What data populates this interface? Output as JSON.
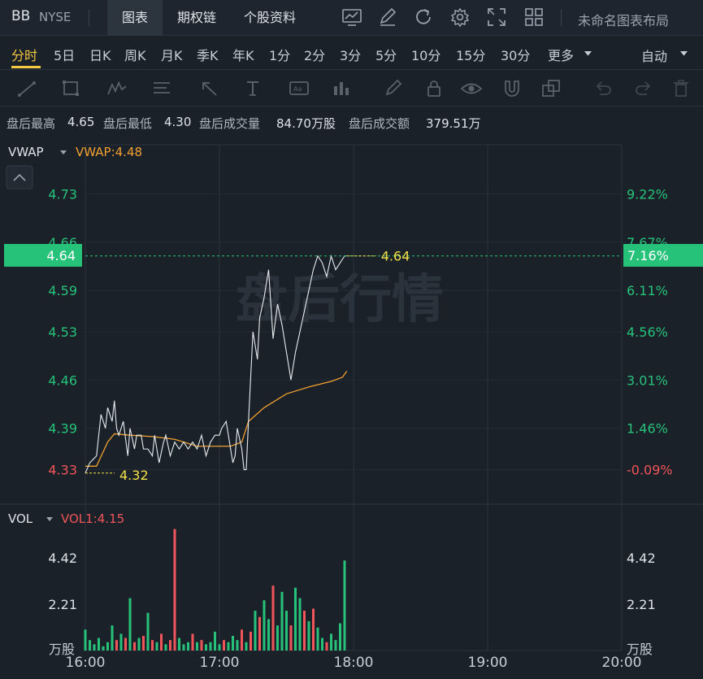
{
  "header": {
    "symbol": "BB",
    "exchange": "NYSE",
    "tabs": [
      {
        "label": "图表",
        "active": true
      },
      {
        "label": "期权链",
        "active": false
      },
      {
        "label": "个股资料",
        "active": false
      }
    ],
    "layout_name": "未命名图表布局"
  },
  "toolbar_icons": [
    "indicator-icon",
    "draw-icon",
    "refresh-icon",
    "settings-icon",
    "fullscreen-icon",
    "layout-grid-icon"
  ],
  "periods": {
    "items": [
      "分时",
      "5日",
      "日K",
      "周K",
      "月K",
      "季K",
      "年K",
      "1分",
      "2分",
      "3分",
      "5分",
      "10分",
      "15分",
      "30分",
      "更多"
    ],
    "active": "分时",
    "auto_label": "自动"
  },
  "drawing_tools": [
    "trend-line-icon",
    "rectangle-icon",
    "pattern-icon",
    "fib-icon",
    "arrow-icon",
    "text-icon",
    "note-icon",
    "measure-icon",
    "brush-icon",
    "lock-icon",
    "eye-icon",
    "magnet-icon",
    "copy-icon",
    "undo-icon",
    "redo-icon",
    "trash-icon"
  ],
  "info": {
    "high_label": "盘后最高",
    "high_value": "4.65",
    "low_label": "盘后最低",
    "low_value": "4.30",
    "volume_label": "盘后成交量",
    "volume_value": "84.70万股",
    "amount_label": "盘后成交额",
    "amount_value": "379.51万"
  },
  "price_panel": {
    "indicator_name": "VWAP",
    "indicator_value": "VWAP:4.48",
    "watermark": "盘后行情",
    "last_price_label": "4.64",
    "last_pct_label": "7.16%",
    "max_label": "4.64",
    "min_label": "4.32",
    "colors": {
      "up": "#27c27a",
      "down": "#f0555a",
      "vwap": "#f0a030",
      "price": "#e8ecf0",
      "marker": "#f5e14a"
    }
  },
  "volume_panel": {
    "indicator_name": "VOL",
    "indicator_value": "VOL1:4.15",
    "unit_label": "万股"
  },
  "chart_data": {
    "type": "line",
    "xlabel": "",
    "ylabel": "",
    "x_ticks": [
      "16:00",
      "17:00",
      "18:00",
      "19:00",
      "20:00"
    ],
    "x_range": [
      "16:00",
      "20:00"
    ],
    "price_ticks": [
      "4.73",
      "4.66",
      "4.59",
      "4.53",
      "4.46",
      "4.39",
      "4.33"
    ],
    "pct_ticks": [
      "9.22%",
      "7.67%",
      "6.11%",
      "4.56%",
      "3.01%",
      "1.46%",
      "-0.09%"
    ],
    "ylim": [
      4.3,
      4.76
    ],
    "series": [
      {
        "name": "VWAP",
        "x": [
          "16:00",
          "16:05",
          "16:10",
          "16:13",
          "16:20",
          "16:30",
          "16:40",
          "16:50",
          "17:00",
          "17:05",
          "17:10",
          "17:13",
          "17:20",
          "17:30",
          "17:40",
          "17:50",
          "17:55",
          "17:57"
        ],
        "values": [
          4.335,
          4.335,
          4.37,
          4.382,
          4.38,
          4.378,
          4.374,
          4.364,
          4.364,
          4.364,
          4.37,
          4.4,
          4.42,
          4.44,
          4.45,
          4.458,
          4.464,
          4.473
        ]
      },
      {
        "name": "",
        "x": [
          "16:00",
          "16:02",
          "16:05",
          "16:07",
          "16:09",
          "16:10",
          "16:12",
          "16:13",
          "16:14",
          "16:15",
          "16:17",
          "16:19",
          "16:20",
          "16:22",
          "16:23",
          "16:25",
          "16:26",
          "16:28",
          "16:30",
          "16:31",
          "16:33",
          "16:35",
          "16:36",
          "16:38",
          "16:40",
          "16:42",
          "16:44",
          "16:46",
          "16:48",
          "16:50",
          "16:52",
          "16:54",
          "16:56",
          "16:58",
          "17:00",
          "17:01",
          "17:03",
          "17:04",
          "17:05",
          "17:06",
          "17:07",
          "17:08",
          "17:10",
          "17:11",
          "17:12",
          "17:13",
          "17:15",
          "17:17",
          "17:18",
          "17:20",
          "17:22",
          "17:24",
          "17:26",
          "17:28",
          "17:30",
          "17:32",
          "17:34",
          "17:36",
          "17:38",
          "17:40",
          "17:42",
          "17:44",
          "17:46",
          "17:48",
          "17:50",
          "17:52",
          "17:54",
          "17:56",
          "17:57"
        ],
        "values": [
          4.325,
          4.34,
          4.35,
          4.41,
          4.39,
          4.42,
          4.4,
          4.43,
          4.39,
          4.38,
          4.4,
          4.35,
          4.39,
          4.36,
          4.38,
          4.38,
          4.36,
          4.36,
          4.35,
          4.38,
          4.34,
          4.37,
          4.38,
          4.35,
          4.37,
          4.36,
          4.37,
          4.36,
          4.37,
          4.36,
          4.38,
          4.35,
          4.37,
          4.38,
          4.38,
          4.39,
          4.4,
          4.38,
          4.36,
          4.34,
          4.35,
          4.39,
          4.36,
          4.33,
          4.33,
          4.4,
          4.53,
          4.49,
          4.55,
          4.58,
          4.62,
          4.52,
          4.57,
          4.54,
          4.5,
          4.46,
          4.5,
          4.53,
          4.56,
          4.59,
          4.62,
          4.64,
          4.63,
          4.61,
          4.64,
          4.62,
          4.63,
          4.64,
          4.64
        ]
      },
      {
        "name": "VOL",
        "type": "bar",
        "ylim": [
          0,
          6.6
        ],
        "volume_ticks": [
          "4.42",
          "2.21"
        ],
        "x": [
          "16:00",
          "16:02",
          "16:04",
          "16:06",
          "16:08",
          "16:10",
          "16:12",
          "16:14",
          "16:16",
          "16:18",
          "16:20",
          "16:22",
          "16:24",
          "16:26",
          "16:28",
          "16:30",
          "16:32",
          "16:34",
          "16:36",
          "16:38",
          "16:40",
          "16:42",
          "16:44",
          "16:46",
          "16:48",
          "16:50",
          "16:52",
          "16:54",
          "16:56",
          "16:58",
          "17:00",
          "17:02",
          "17:04",
          "17:06",
          "17:08",
          "17:10",
          "17:12",
          "17:14",
          "17:16",
          "17:18",
          "17:20",
          "17:22",
          "17:24",
          "17:26",
          "17:28",
          "17:30",
          "17:32",
          "17:34",
          "17:36",
          "17:38",
          "17:40",
          "17:42",
          "17:44",
          "17:46",
          "17:48",
          "17:50",
          "17:52",
          "17:54",
          "17:56"
        ],
        "values": [
          1.0,
          0.5,
          0.3,
          0.6,
          0.2,
          0.4,
          1.2,
          0.5,
          0.8,
          0.6,
          2.5,
          0.4,
          0.6,
          0.7,
          1.8,
          0.5,
          0.4,
          0.8,
          0.3,
          0.5,
          5.8,
          0.6,
          0.3,
          0.4,
          0.8,
          0.4,
          0.5,
          0.3,
          0.4,
          0.9,
          0.3,
          0.5,
          0.4,
          0.7,
          0.5,
          1.0,
          0.4,
          0.9,
          1.9,
          1.6,
          2.4,
          1.5,
          3.1,
          1.2,
          2.8,
          1.9,
          1.2,
          3.0,
          2.5,
          1.9,
          1.4,
          2.0,
          1.1,
          0.6,
          0.4,
          0.8,
          0.5,
          1.3,
          4.3
        ],
        "colors": [
          "up",
          "up",
          "up",
          "up",
          "up",
          "up",
          "up",
          "down",
          "up",
          "down",
          "up",
          "down",
          "up",
          "down",
          "up",
          "down",
          "up",
          "down",
          "up",
          "down",
          "down",
          "up",
          "up",
          "up",
          "down",
          "up",
          "down",
          "up",
          "up",
          "up",
          "up",
          "down",
          "up",
          "up",
          "up",
          "down",
          "up",
          "down",
          "up",
          "down",
          "up",
          "up",
          "down",
          "up",
          "up",
          "up",
          "down",
          "up",
          "up",
          "down",
          "up",
          "down",
          "up",
          "up",
          "down",
          "up",
          "up",
          "up",
          "up"
        ]
      }
    ],
    "grid": true
  }
}
